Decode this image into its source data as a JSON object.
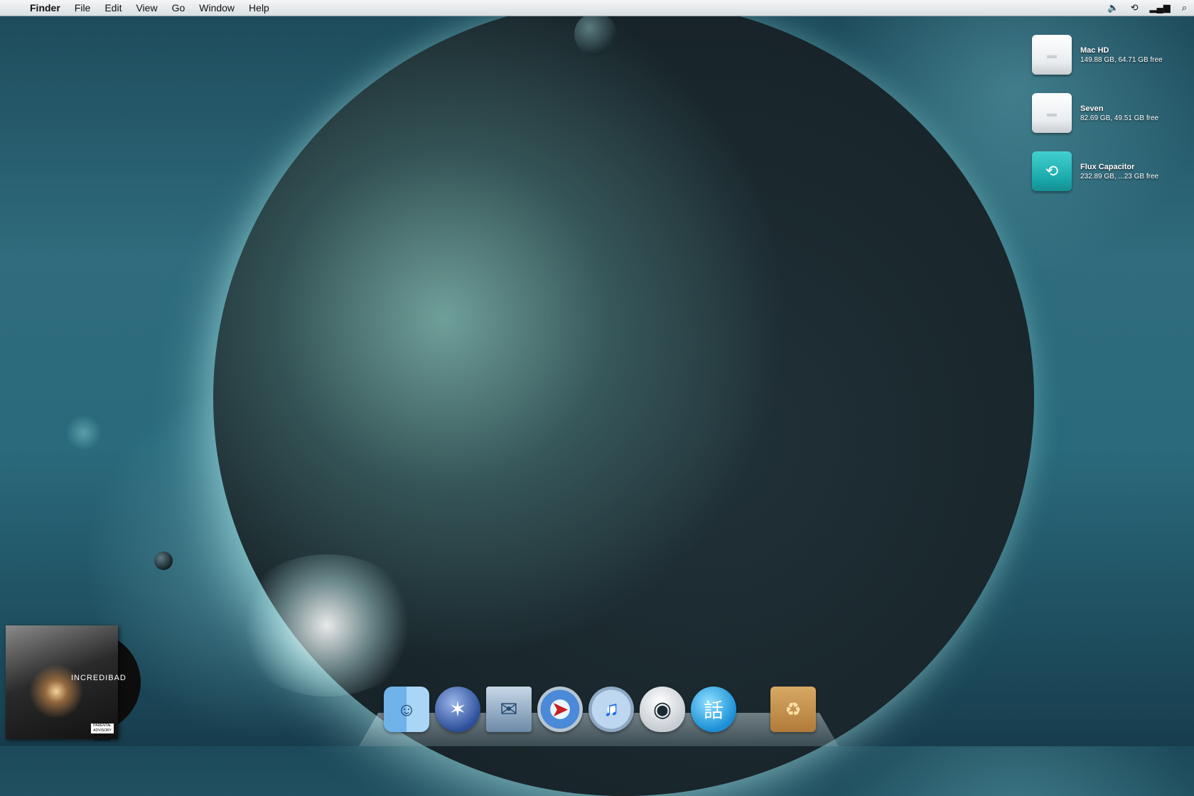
{
  "menubar": {
    "apple": "",
    "app_name": "Finder",
    "items": [
      "File",
      "Edit",
      "View",
      "Go",
      "Window",
      "Help"
    ],
    "right_icons": [
      "volume-icon",
      "time-machine-icon",
      "wifi-icon",
      "spotlight-icon"
    ]
  },
  "volumes": [
    {
      "name": "Mac HD",
      "info": "149.88 GB, 64.71 GB free",
      "icon": "hard-drive-icon"
    },
    {
      "name": "Seven",
      "info": "82.69 GB, 49.51 GB free",
      "icon": "hard-drive-icon"
    },
    {
      "name": "Flux Capacitor",
      "info": "232.89 GB, ...23 GB free",
      "icon": "time-machine-drive-icon"
    }
  ],
  "album": {
    "title": "INCREDIBAD",
    "advisory": "PARENTAL ADVISORY EXPLICIT CONTENT"
  },
  "dock": {
    "apps": [
      "Finder",
      "Dashboard",
      "Mail",
      "Safari",
      "iTunes",
      "Eve",
      "Chat",
      "Trash"
    ],
    "glyphs": {
      "finder": "☺",
      "dashboard": "✶",
      "mail": "✉",
      "safari": "➤",
      "itunes": "♫",
      "eve": "◉",
      "chat": "話",
      "trash": "♻"
    }
  },
  "colors": {
    "menubar": "#e6ebee",
    "time_machine": "#1fb3b3"
  }
}
